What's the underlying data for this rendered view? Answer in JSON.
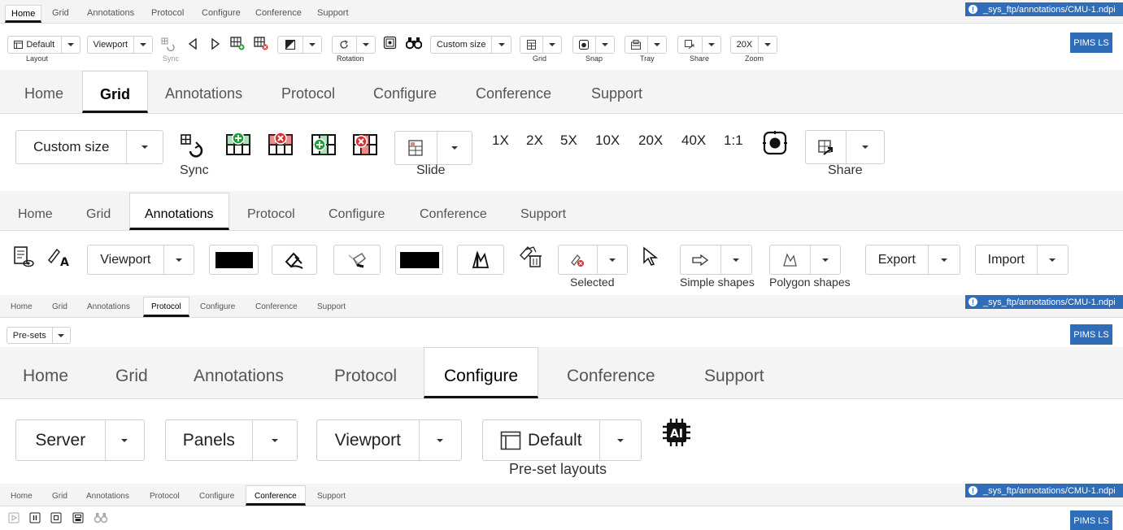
{
  "top": {
    "tabs": [
      "Home",
      "Grid",
      "Annotations",
      "Protocol",
      "Configure",
      "Conference",
      "Support"
    ],
    "active_tab": "Home",
    "path": "_sys_ftp/annotations/CMU-1.ndpi",
    "pims": "PIMS LS",
    "layout_value": "Default",
    "layout_label": "Layout",
    "viewport_value": "Viewport",
    "sync_label": "Sync",
    "rotation_label": "Rotation",
    "size_value": "Custom size",
    "grid_label": "Grid",
    "snap_label": "Snap",
    "tray_label": "Tray",
    "share_label": "Share",
    "zoom_value": "20X",
    "zoom_label": "Zoom"
  },
  "grid": {
    "tabs": [
      "Home",
      "Grid",
      "Annotations",
      "Protocol",
      "Configure",
      "Conference",
      "Support"
    ],
    "active_tab": "Grid",
    "size_value": "Custom size",
    "sync_label": "Sync",
    "slide_label": "Slide",
    "zooms": [
      "1X",
      "2X",
      "5X",
      "10X",
      "20X",
      "40X",
      "1:1"
    ],
    "share_label": "Share"
  },
  "annotations": {
    "tabs": [
      "Home",
      "Grid",
      "Annotations",
      "Protocol",
      "Configure",
      "Conference",
      "Support"
    ],
    "active_tab": "Annotations",
    "viewport_value": "Viewport",
    "selected_label": "Selected",
    "simple_shapes_label": "Simple shapes",
    "polygon_shapes_label": "Polygon shapes",
    "export_label": "Export",
    "import_label": "Import"
  },
  "protocol": {
    "tabs": [
      "Home",
      "Grid",
      "Annotations",
      "Protocol",
      "Configure",
      "Conference",
      "Support"
    ],
    "active_tab": "Protocol",
    "path": "_sys_ftp/annotations/CMU-1.ndpi",
    "pims": "PIMS LS",
    "presets_value": "Pre-sets"
  },
  "configure": {
    "tabs": [
      "Home",
      "Grid",
      "Annotations",
      "Protocol",
      "Configure",
      "Conference",
      "Support"
    ],
    "active_tab": "Configure",
    "server_label": "Server",
    "panels_label": "Panels",
    "viewport_label": "Viewport",
    "default_label": "Default",
    "preset_layouts_label": "Pre-set layouts",
    "ai_text": "AI"
  },
  "conference": {
    "tabs": [
      "Home",
      "Grid",
      "Annotations",
      "Protocol",
      "Configure",
      "Conference",
      "Support"
    ],
    "active_tab": "Conference",
    "path": "_sys_ftp/annotations/CMU-1.ndpi",
    "pims": "PIMS LS"
  },
  "colors": {
    "accent": "#2f6db8",
    "green": "#1f9e3a",
    "red": "#d43030"
  }
}
